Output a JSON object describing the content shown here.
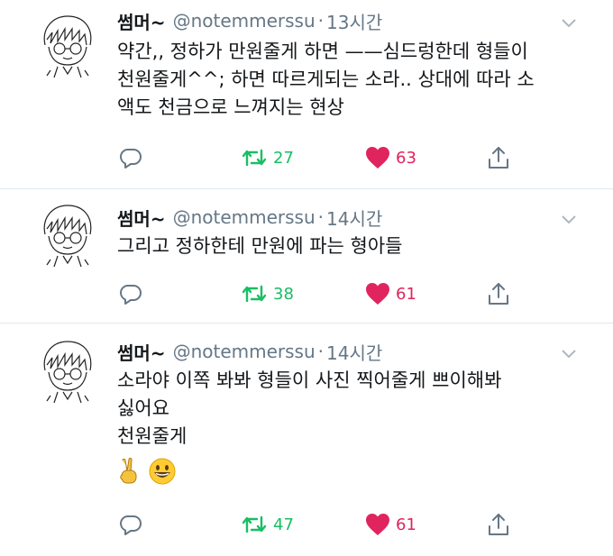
{
  "colors": {
    "text": "#14171a",
    "secondary": "#657786",
    "retweet": "#17bf63",
    "like": "#e0245e",
    "divider": "#e1e8ed"
  },
  "tweets": [
    {
      "name": "썸머~",
      "handle": "@notemmerssu",
      "dot": "·",
      "time": "13시간",
      "lines": [
        "약간,, 정하가 만원줄게 하면 ——심드렁한데 형들이",
        "천원줄게^^; 하면 따르게되는 소라.. 상대에 따라 소",
        "액도 천금으로 느껴지는 현상"
      ],
      "emojis": [],
      "retweets": "27",
      "likes": "63"
    },
    {
      "name": "썸머~",
      "handle": "@notemmerssu",
      "dot": "·",
      "time": "14시간",
      "lines": [
        "그리고 정하한테 만원에 파는 형아들"
      ],
      "emojis": [],
      "retweets": "38",
      "likes": "61"
    },
    {
      "name": "썸머~",
      "handle": "@notemmerssu",
      "dot": "·",
      "time": "14시간",
      "lines": [
        "소라야 이쪽 봐봐 형들이 사진 찍어줄게 쁘이해봐",
        "싫어요",
        "천원줄게"
      ],
      "emojis": [
        "victory-hand",
        "grinning-face"
      ],
      "retweets": "47",
      "likes": "61"
    }
  ]
}
